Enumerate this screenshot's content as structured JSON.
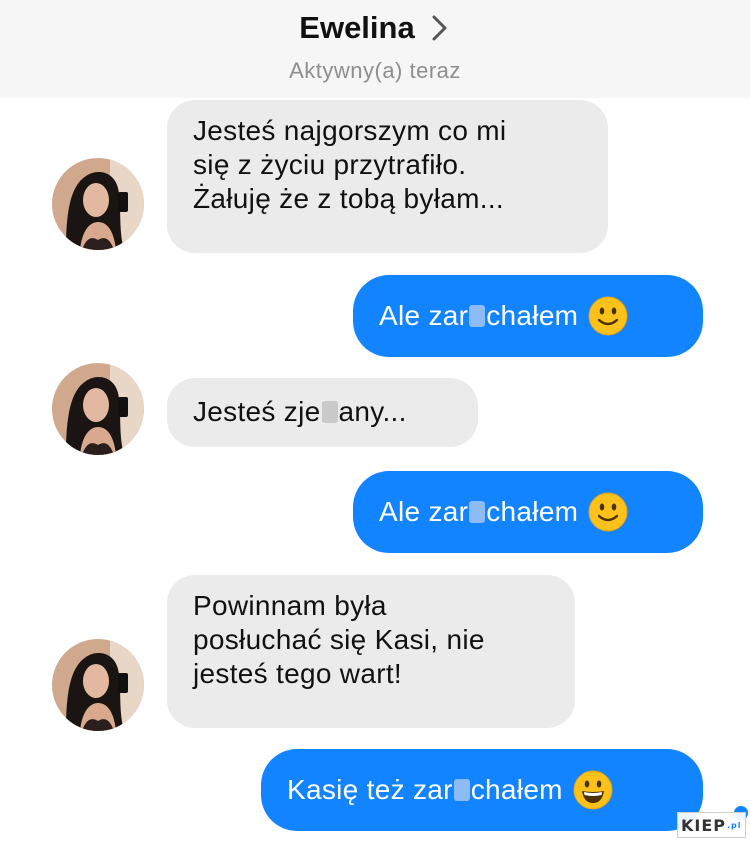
{
  "header": {
    "contact_name": "Ewelina",
    "status": "Aktywny(a) teraz"
  },
  "messages": [
    {
      "direction": "incoming",
      "lines": [
        "Jesteś najgorszym co mi",
        "się z życiu przytrafiło.",
        "Żałuję że z tobą byłam..."
      ]
    },
    {
      "direction": "outgoing",
      "text_before": "Ale zar",
      "text_after": "chałem",
      "emoji": "slightly-smiling-face"
    },
    {
      "direction": "incoming",
      "text_before": "Jesteś zje",
      "text_after": "any..."
    },
    {
      "direction": "outgoing",
      "text_before": "Ale zar",
      "text_after": "chałem",
      "emoji": "slightly-smiling-face"
    },
    {
      "direction": "incoming",
      "lines": [
        "Powinnam była",
        "posłuchać się Kasi, nie",
        "jesteś tego wart!"
      ]
    },
    {
      "direction": "outgoing",
      "text_before": "Kasię też zar",
      "text_after": "chałem",
      "emoji": "grinning-face"
    }
  ],
  "watermark": {
    "text": "KIEP",
    "suffix": ".pl"
  },
  "colors": {
    "outgoing_bubble": "#1284ff",
    "incoming_bubble": "#ebebeb",
    "header_bg": "#f6f6f6",
    "status_text": "#8e8e8e"
  },
  "icons": [
    "chevron-right-icon",
    "avatar",
    "slightly-smiling-face-icon",
    "grinning-face-icon",
    "read-receipt-icon"
  ]
}
